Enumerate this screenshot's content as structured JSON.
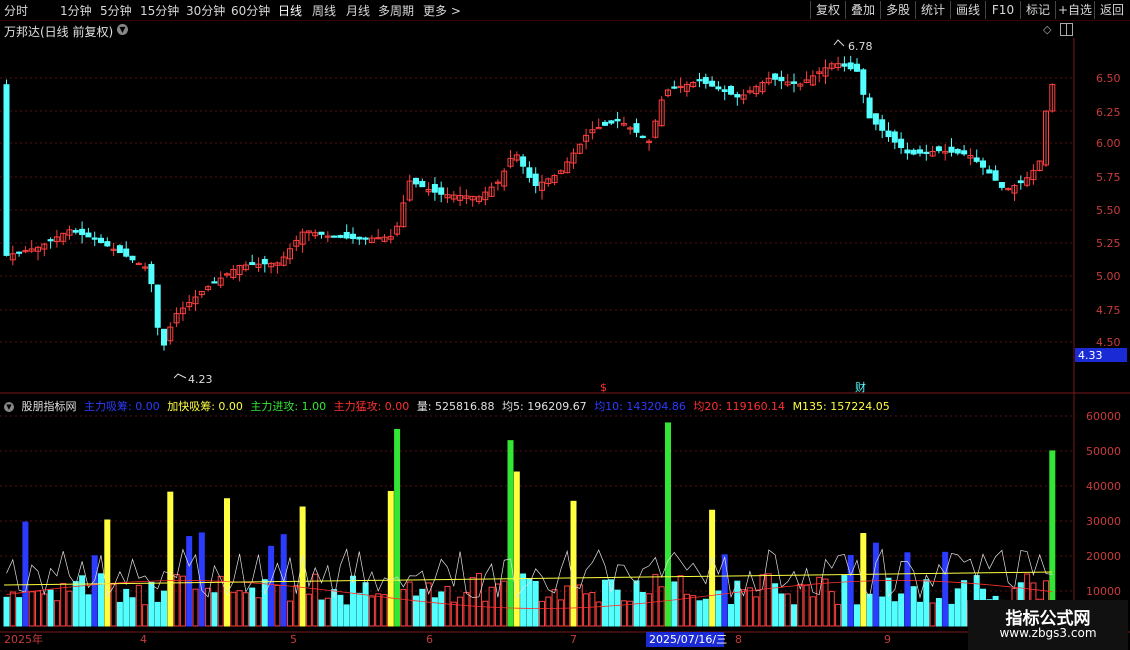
{
  "toolbar": {
    "periods": [
      "分时",
      "1分钟",
      "5分钟",
      "15分钟",
      "30分钟",
      "60分钟",
      "日线",
      "周线",
      "月线",
      "多周期",
      "更多 >"
    ],
    "active_period": "日线",
    "right_buttons": [
      "复权",
      "叠加",
      "多股",
      "统计",
      "画线",
      "F10",
      "标记",
      "+自选",
      "返回"
    ]
  },
  "main_chart": {
    "title": "万邦达(日线 前复权)",
    "high_label": "6.78",
    "low_label": "4.23",
    "price_axis": [
      "6.50",
      "6.25",
      "6.00",
      "5.75",
      "5.50",
      "5.25",
      "5.00",
      "4.75",
      "4.50"
    ],
    "current_price_tag": "4.33",
    "marker_dollar": "$",
    "marker_cai": "财"
  },
  "indicator": {
    "name": "股朋指标网",
    "items": [
      {
        "label": "主力吸筹: 0.00",
        "color": "#2c3cff"
      },
      {
        "label": "加快吸筹: 0.00",
        "color": "#ffff40"
      },
      {
        "label": "主力进攻: 1.00",
        "color": "#33e633"
      },
      {
        "label": "主力猛攻: 0.00",
        "color": "#ff3030"
      },
      {
        "label": "量: 525816.88",
        "color": "#e0e0e0"
      },
      {
        "label": "均5: 196209.67",
        "color": "#e0e0e0"
      },
      {
        "label": "均10: 143204.86",
        "color": "#2c3cff"
      },
      {
        "label": "均20: 119160.14",
        "color": "#ff3030"
      },
      {
        "label": "M135: 157224.05",
        "color": "#ffff40"
      }
    ],
    "axis": [
      "60000",
      "50000",
      "40000",
      "30000",
      "20000",
      "10000"
    ]
  },
  "date_axis": {
    "labels": [
      "2025年",
      "4",
      "5",
      "6",
      "7",
      "8",
      "9"
    ],
    "selected_date": "2025/07/16/三"
  },
  "colors": {
    "up": "#ff4040",
    "down": "#54ffff",
    "grid": "#7a1a1a",
    "background": "#000000"
  },
  "watermark": {
    "title": "指标公式网",
    "url": "www.zbgs3.com"
  }
}
